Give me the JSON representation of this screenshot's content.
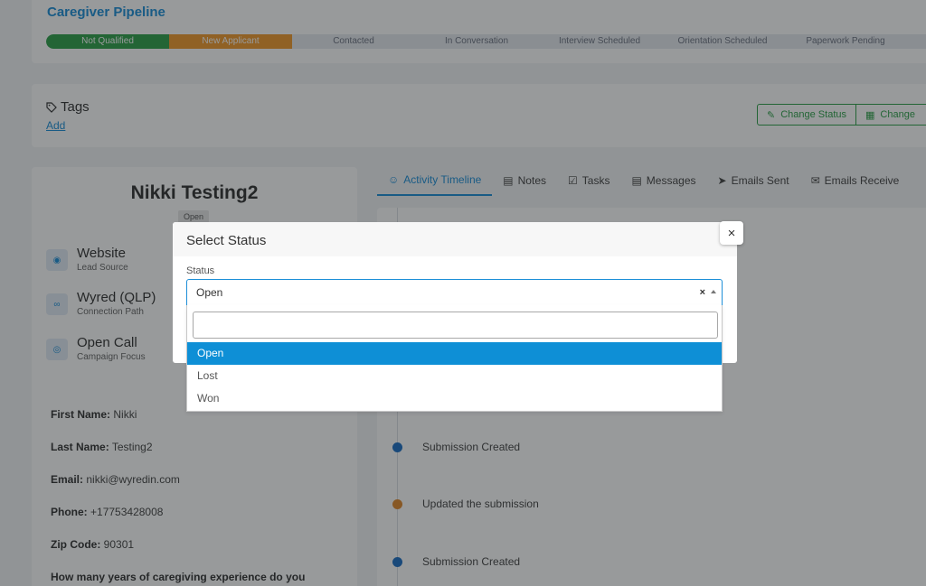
{
  "pipeline": {
    "title": "Caregiver Pipeline",
    "stages": [
      "Not Qualified",
      "New Applicant",
      "Contacted",
      "In Conversation",
      "Interview Scheduled",
      "Orientation Scheduled",
      "Paperwork Pending"
    ]
  },
  "tags": {
    "title": "Tags",
    "add_label": "Add",
    "change_status_label": "Change Status",
    "change_other_label": "Change"
  },
  "profile": {
    "name": "Nikki Testing2",
    "status_badge": "Open",
    "meta": [
      {
        "title": "Website",
        "subtitle": "Lead Source"
      },
      {
        "title": "Wyred (QLP)",
        "subtitle": "Connection Path"
      },
      {
        "title": "Open Call",
        "subtitle": "Campaign Focus"
      }
    ],
    "fields": [
      {
        "label": "First Name:",
        "value": "Nikki"
      },
      {
        "label": "Last Name:",
        "value": "Testing2"
      },
      {
        "label": "Email:",
        "value": "nikki@wyredin.com"
      },
      {
        "label": "Phone:",
        "value": "+17753428008"
      },
      {
        "label": "Zip Code:",
        "value": "90301"
      },
      {
        "label": "How many years of caregiving experience do you",
        "value": ""
      }
    ]
  },
  "tabs": [
    "Activity Timeline",
    "Notes",
    "Tasks",
    "Messages",
    "Emails Sent",
    "Emails Receive"
  ],
  "timeline": [
    {
      "text": "Submission Created",
      "color": "#1d6fc4"
    },
    {
      "text": "Updated the submission",
      "color": "#e08a2e"
    },
    {
      "text": "Submission Created",
      "color": "#1d6fc4"
    }
  ],
  "modal": {
    "title": "Select Status",
    "close_symbol": "×",
    "status_label": "Status",
    "selected_value": "Open",
    "clear_symbol": "×",
    "search_value": "",
    "options": [
      "Open",
      "Lost",
      "Won"
    ]
  }
}
